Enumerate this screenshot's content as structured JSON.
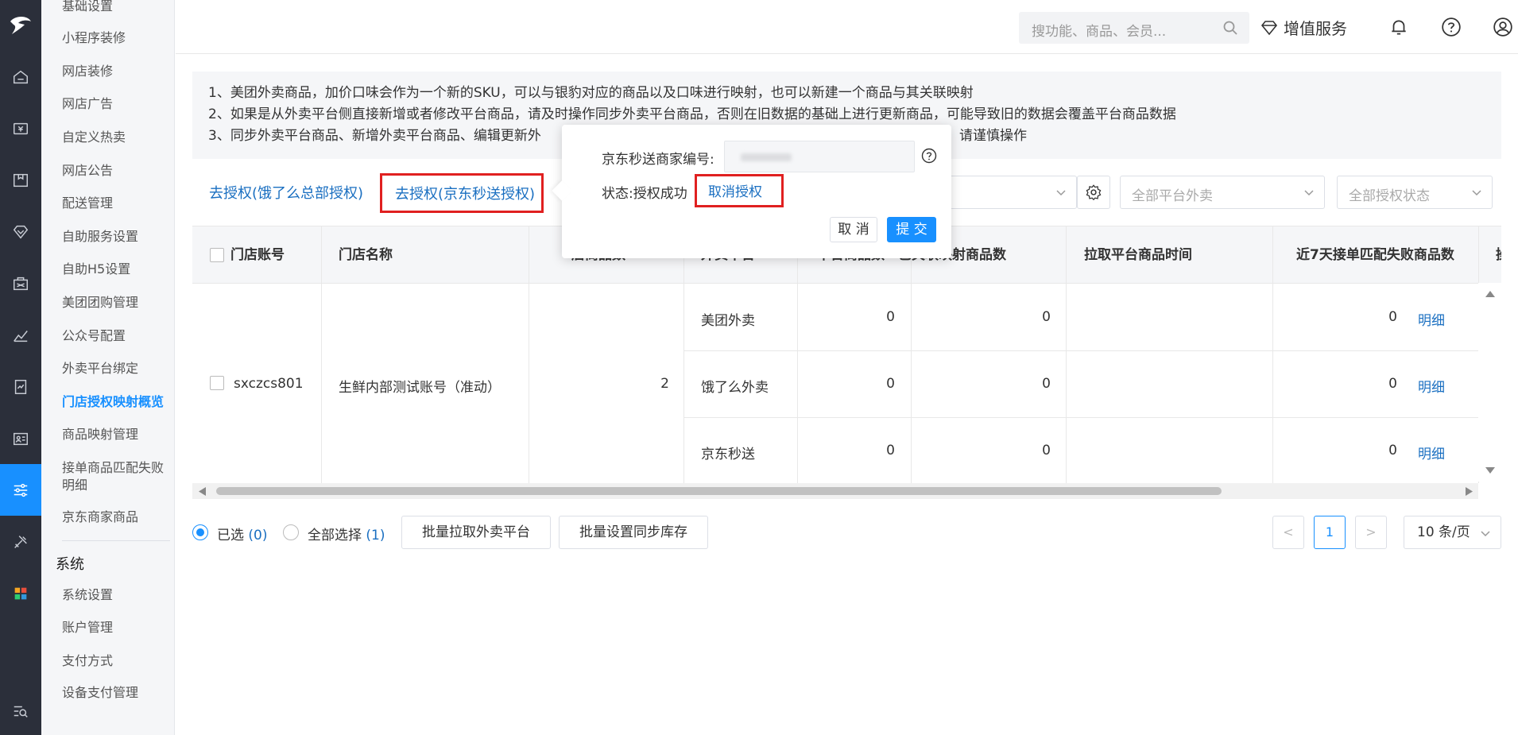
{
  "submenu": {
    "items": [
      "基础设置",
      "小程序装修",
      "网店装修",
      "网店广告",
      "自定义热卖",
      "网店公告",
      "配送管理",
      "自助服务设置",
      "自助H5设置",
      "美团团购管理",
      "公众号配置",
      "外卖平台绑定",
      "门店授权映射概览",
      "商品映射管理",
      "接单商品匹配失败明细",
      "京东商家商品"
    ],
    "section": "系统",
    "system_items": [
      "系统设置",
      "账户管理",
      "支付方式",
      "设备支付管理"
    ]
  },
  "topbar": {
    "search_placeholder": "搜功能、商品、会员...",
    "vip_label": "增值服务"
  },
  "notice": {
    "lines": [
      "1、美团外卖商品，加价口味会作为一个新的SKU，可以与银豹对应的商品以及口味进行映射，也可以新建一个商品与其关联映射",
      "2、如果是从外卖平台侧直接新增或者修改平台商品，请及时操作同步外卖平台商品，否则在旧数据的基础上进行更新商品，可能导致旧的数据会覆盖平台商品数据",
      "3、同步外卖平台商品、新增外卖平台商品、编辑更新外",
      "，请谨慎操作"
    ]
  },
  "filters": {
    "link_eleme": "去授权(饿了么总部授权)",
    "link_jd": "去授权(京东秒送授权)",
    "platform_select": "全部平台外卖",
    "auth_select": "全部授权状态"
  },
  "table": {
    "headers": [
      "门店账号",
      "门店名称",
      "",
      "外卖平台",
      "平台商品数",
      "已关联映射商品数",
      "拉取平台商品时间",
      "近7天接单匹配失败商品数"
    ],
    "header_partial": {
      "store_goods": "店商品数",
      "platform": "外卖平台",
      "platform_goods": "平台商品数",
      "mapped": "已关联映射商品数"
    },
    "row": {
      "account": "sxczcs801",
      "store_name": "生鲜内部测试账号（准动）",
      "store_goods": "2",
      "platforms": [
        {
          "name": "美团外卖",
          "platform_goods": "0",
          "mapped": "0",
          "pull_time": "",
          "fail": "0",
          "action": "明细"
        },
        {
          "name": "饿了么外卖",
          "platform_goods": "0",
          "mapped": "0",
          "pull_time": "",
          "fail": "0",
          "action": "明细"
        },
        {
          "name": "京东秒送",
          "platform_goods": "0",
          "mapped": "0",
          "pull_time": "",
          "fail": "0",
          "action": "明细"
        }
      ]
    }
  },
  "footer": {
    "selected_label": "已选",
    "selected_count": "(0)",
    "all_label": "全部选择",
    "all_count": "(1)",
    "btn_pull": "批量拉取外卖平台",
    "btn_stock": "批量设置同步库存",
    "page_current": "1",
    "page_prev": "<",
    "page_next": ">",
    "page_size": "10 条/页"
  },
  "popover": {
    "merchant_label": "京东秒送商家编号:",
    "status_label": "状态:授权成功",
    "cancel_auth": "取消授权",
    "btn_cancel": "取 消",
    "btn_submit": "提 交"
  },
  "colors": {
    "accent": "#1890ff",
    "link": "#1a6fc1",
    "highlight_border": "#e02020",
    "rail": "#2b2f3a"
  }
}
